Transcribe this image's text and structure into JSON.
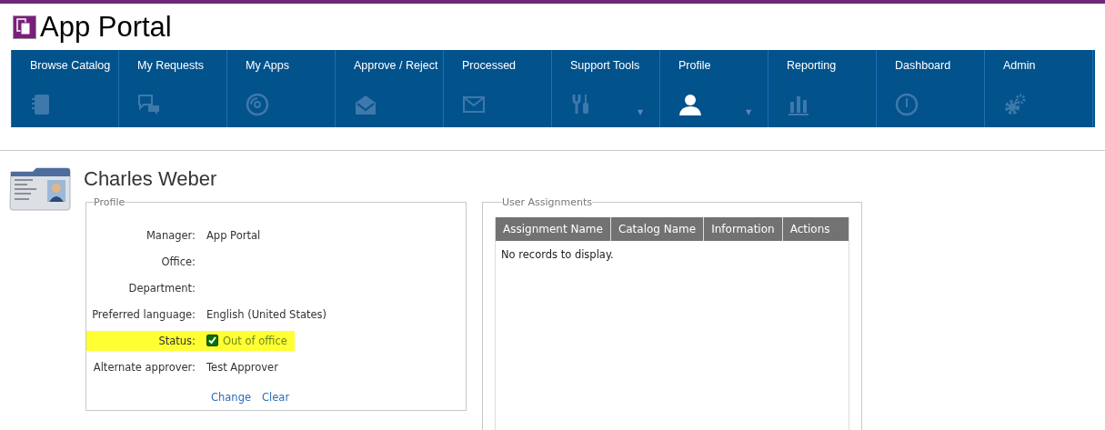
{
  "header": {
    "title": "App Portal"
  },
  "nav": [
    {
      "label": "Browse Catalog",
      "selected": false,
      "dropdown": false
    },
    {
      "label": "My Requests",
      "selected": false,
      "dropdown": false
    },
    {
      "label": "My Apps",
      "selected": false,
      "dropdown": false
    },
    {
      "label": "Approve / Reject",
      "selected": false,
      "dropdown": false
    },
    {
      "label": "Processed",
      "selected": false,
      "dropdown": false
    },
    {
      "label": "Support Tools",
      "selected": false,
      "dropdown": true
    },
    {
      "label": "Profile",
      "selected": true,
      "dropdown": true
    },
    {
      "label": "Reporting",
      "selected": false,
      "dropdown": false
    },
    {
      "label": "Dashboard",
      "selected": false,
      "dropdown": false
    },
    {
      "label": "Admin",
      "selected": false,
      "dropdown": false
    }
  ],
  "dropdown_caret": "▼",
  "user": {
    "name": "Charles Weber"
  },
  "profile": {
    "legend": "Profile",
    "fields": [
      {
        "kind": "text",
        "label": "Manager:",
        "value": "App Portal",
        "highlighted": false
      },
      {
        "kind": "text",
        "label": "Office:",
        "highlighted": false
      },
      {
        "kind": "text",
        "label": "Department:",
        "highlighted": false
      },
      {
        "kind": "text",
        "label": "Preferred language:",
        "value": "English (United States)",
        "highlighted": false
      },
      {
        "kind": "checkbox",
        "label": "Status:",
        "value": "Out of office",
        "checked": true,
        "highlighted": true
      },
      {
        "kind": "text",
        "label": "Alternate approver:",
        "value": "Test Approver",
        "highlighted": false
      }
    ],
    "links": [
      "Change",
      "Clear"
    ]
  },
  "assignments": {
    "legend": "User Assignments",
    "columns": [
      "Assignment Name",
      "Catalog Name",
      "Information",
      "Actions"
    ],
    "empty_message": "No records to display."
  }
}
